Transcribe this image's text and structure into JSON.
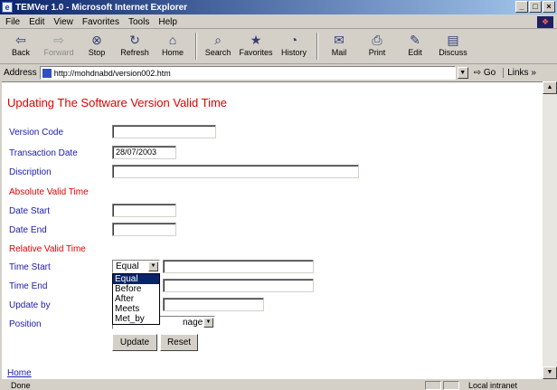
{
  "window": {
    "title": "TEMVer 1.0 - Microsoft Internet Explorer",
    "controls": [
      "_",
      "Ɖ",
      "x"
    ]
  },
  "menu": [
    "File",
    "Edit",
    "View",
    "Favorites",
    "Tools",
    "Help"
  ],
  "toolbar": [
    {
      "label": "Back",
      "icon": "back-arrow-icon",
      "glyph": "⇦",
      "enabled": true
    },
    {
      "label": "Forward",
      "icon": "forward-arrow-icon",
      "glyph": "⇨",
      "enabled": false
    },
    {
      "label": "Stop",
      "icon": "stop-icon",
      "glyph": "⊗",
      "enabled": true
    },
    {
      "label": "Refresh",
      "icon": "refresh-icon",
      "glyph": "↻",
      "enabled": true
    },
    {
      "label": "Home",
      "icon": "home-icon",
      "glyph": "⌂",
      "enabled": true
    },
    {
      "label": "Search",
      "icon": "search-icon",
      "glyph": "⌕",
      "enabled": true
    },
    {
      "label": "Favorites",
      "icon": "favorites-icon",
      "glyph": "★",
      "enabled": true
    },
    {
      "label": "History",
      "icon": "history-icon",
      "glyph": "◔",
      "enabled": true
    },
    {
      "label": "Mail",
      "icon": "mail-icon",
      "glyph": "✉",
      "enabled": true
    },
    {
      "label": "Print",
      "icon": "print-icon",
      "glyph": "⎙",
      "enabled": true
    },
    {
      "label": "Edit",
      "icon": "edit-icon",
      "glyph": "✎",
      "enabled": true
    },
    {
      "label": "Discuss",
      "icon": "discuss-icon",
      "glyph": "▤",
      "enabled": true
    }
  ],
  "address": {
    "label": "Address",
    "url": "http://mohdnabd/version002.htm",
    "go": "Go",
    "links": "Links"
  },
  "form": {
    "title": "Updating The Software Version Valid Time",
    "version_code_label": "Version Code",
    "version_code_value": "",
    "transaction_date_label": "Transaction Date",
    "transaction_date_value": "28/07/2003",
    "description_label": "Discription",
    "description_value": "",
    "absolute_header": "Absolute Valid Time",
    "date_start_label": "Date Start",
    "date_end_label": "Date End",
    "relative_header": "Relative Valid Time",
    "time_start_label": "Time Start",
    "time_start_selected": "Equal",
    "time_end_label": "Time End",
    "update_by_label": "Update by",
    "position_label": "Position",
    "position_selected": "nager",
    "relation_options": [
      "Equal",
      "Before",
      "After",
      "Meets",
      "Met_by"
    ],
    "update_button": "Update",
    "reset_button": "Reset",
    "home_link": "Home"
  },
  "status": {
    "text": "Done",
    "zone": "Local intranet"
  }
}
